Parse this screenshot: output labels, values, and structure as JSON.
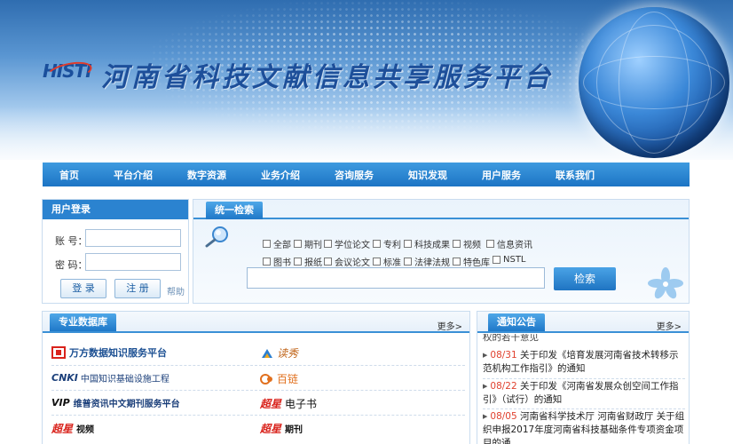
{
  "header": {
    "logo_text": "HISTI",
    "site_title": "河南省科技文献信息共享服务平台"
  },
  "nav": [
    "首页",
    "平台介绍",
    "数字资源",
    "业务介绍",
    "咨询服务",
    "知识发现",
    "用户服务",
    "联系我们"
  ],
  "login": {
    "tab_label": "用户登录",
    "account_label": "账 号：",
    "password_label": "密 码：",
    "login_button": "登 录",
    "register_button": "注 册",
    "help_link": "帮助"
  },
  "search": {
    "tab_label": "统一检索",
    "options_row1": [
      "全部",
      "期刊",
      "学位论文",
      "专利",
      "科技成果",
      "视频",
      "信息资讯"
    ],
    "options_row2": [
      "图书",
      "报纸",
      "会议论文",
      "标准",
      "法律法规",
      "特色库",
      "NSTL"
    ],
    "search_button": "检索",
    "query_value": ""
  },
  "databases": {
    "tab_label": "专业数据库",
    "more_link": "更多>",
    "entries": [
      {
        "name": "万方数据知识服务平台",
        "logo": "wanfang-logo"
      },
      {
        "name": "读秀",
        "logo": "duxiu-logo"
      },
      {
        "name": "中国知识基础设施工程",
        "logo": "cnki-logo"
      },
      {
        "name": "百链",
        "logo": "bailian-logo"
      },
      {
        "name": "维普资讯中文期刊服务平台",
        "logo": "vip-logo"
      },
      {
        "name": "电子书",
        "logo": "chaoxing-logo"
      },
      {
        "name": "视频",
        "logo": "chaoxing-logo"
      },
      {
        "name": "期刊",
        "logo": "chaoxing-logo"
      }
    ],
    "logo_texts": {
      "vip": "VIP",
      "chaoxing": "超星",
      "cnki": "CNKI"
    }
  },
  "notices": {
    "tab_label": "通知公告",
    "more_link": "更多>",
    "partial_top_text": "权的若干意见",
    "items": [
      {
        "date": "08/31",
        "text": "关于印发《培育发展河南省技术转移示范机构工作指引》的通知"
      },
      {
        "date": "08/22",
        "text": "关于印发《河南省发展众创空间工作指引》（试行）的通知"
      },
      {
        "date": "08/05",
        "text": "河南省科学技术厅 河南省财政厅 关于组织申报2017年度河南省科技基础条件专项资金项目的通"
      }
    ]
  },
  "colors": {
    "nav_blue": "#1c74c4",
    "title_blue": "#1d4f9a",
    "date_red": "#e0412e",
    "logo_red": "#e03a2a"
  }
}
